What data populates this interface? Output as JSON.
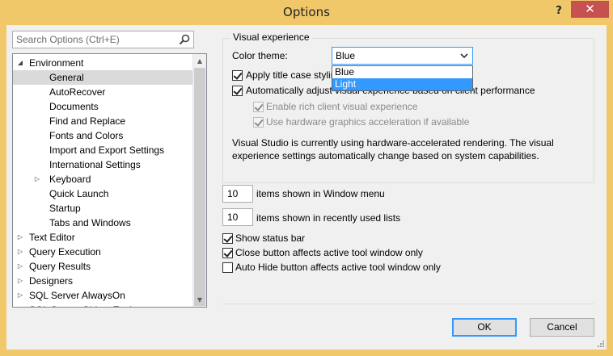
{
  "window": {
    "title": "Options",
    "help_label": "?",
    "close_label": "✕"
  },
  "search": {
    "placeholder": "Search Options (Ctrl+E)"
  },
  "tree": [
    {
      "label": "Environment",
      "arrow": "expanded",
      "level": 0,
      "selected": false
    },
    {
      "label": "General",
      "arrow": "",
      "level": 1,
      "selected": true
    },
    {
      "label": "AutoRecover",
      "arrow": "",
      "level": 1,
      "selected": false
    },
    {
      "label": "Documents",
      "arrow": "",
      "level": 1,
      "selected": false
    },
    {
      "label": "Find and Replace",
      "arrow": "",
      "level": 1,
      "selected": false
    },
    {
      "label": "Fonts and Colors",
      "arrow": "",
      "level": 1,
      "selected": false
    },
    {
      "label": "Import and Export Settings",
      "arrow": "",
      "level": 1,
      "selected": false
    },
    {
      "label": "International Settings",
      "arrow": "",
      "level": 1,
      "selected": false
    },
    {
      "label": "Keyboard",
      "arrow": "collapsed",
      "level": 1,
      "selected": false
    },
    {
      "label": "Quick Launch",
      "arrow": "",
      "level": 1,
      "selected": false
    },
    {
      "label": "Startup",
      "arrow": "",
      "level": 1,
      "selected": false
    },
    {
      "label": "Tabs and Windows",
      "arrow": "",
      "level": 1,
      "selected": false
    },
    {
      "label": "Text Editor",
      "arrow": "collapsed",
      "level": 0,
      "selected": false
    },
    {
      "label": "Query Execution",
      "arrow": "collapsed",
      "level": 0,
      "selected": false
    },
    {
      "label": "Query Results",
      "arrow": "collapsed",
      "level": 0,
      "selected": false
    },
    {
      "label": "Designers",
      "arrow": "collapsed",
      "level": 0,
      "selected": false
    },
    {
      "label": "SQL Server AlwaysOn",
      "arrow": "collapsed",
      "level": 0,
      "selected": false
    },
    {
      "label": "SQL Server Object Explorer",
      "arrow": "collapsed",
      "level": 0,
      "selected": false
    }
  ],
  "visual": {
    "group_title": "Visual experience",
    "color_theme_label": "Color theme:",
    "color_theme_value": "Blue",
    "color_theme_options": [
      "Blue",
      "Light"
    ],
    "highlighted_option": "Light",
    "title_case": {
      "label": "Apply title case styling to menu bar",
      "checked": true
    },
    "auto_adjust": {
      "label": "Automatically adjust visual experience based on client performance",
      "checked": true
    },
    "rich_client": {
      "label": "Enable rich client visual experience",
      "checked": true,
      "disabled": true
    },
    "hw_accel": {
      "label": "Use hardware graphics acceleration if available",
      "checked": true,
      "disabled": true
    },
    "info": "Visual Studio is currently using hardware-accelerated rendering. The visual experience settings automatically change based on system capabilities."
  },
  "window_menu": {
    "value": "10",
    "label": "items shown in Window menu"
  },
  "mru": {
    "value": "10",
    "label": "items shown in recently used lists"
  },
  "status_bar": {
    "label": "Show status bar",
    "checked": true
  },
  "close_button": {
    "label": "Close button affects active tool window only",
    "checked": true
  },
  "auto_hide": {
    "label": "Auto Hide button affects active tool window only",
    "checked": false
  },
  "buttons": {
    "ok": "OK",
    "cancel": "Cancel"
  },
  "colors": {
    "accent": "#3399ff",
    "title_bg": "#f0c86a",
    "close_bg": "#c75050",
    "selected_bg": "#dadada"
  }
}
